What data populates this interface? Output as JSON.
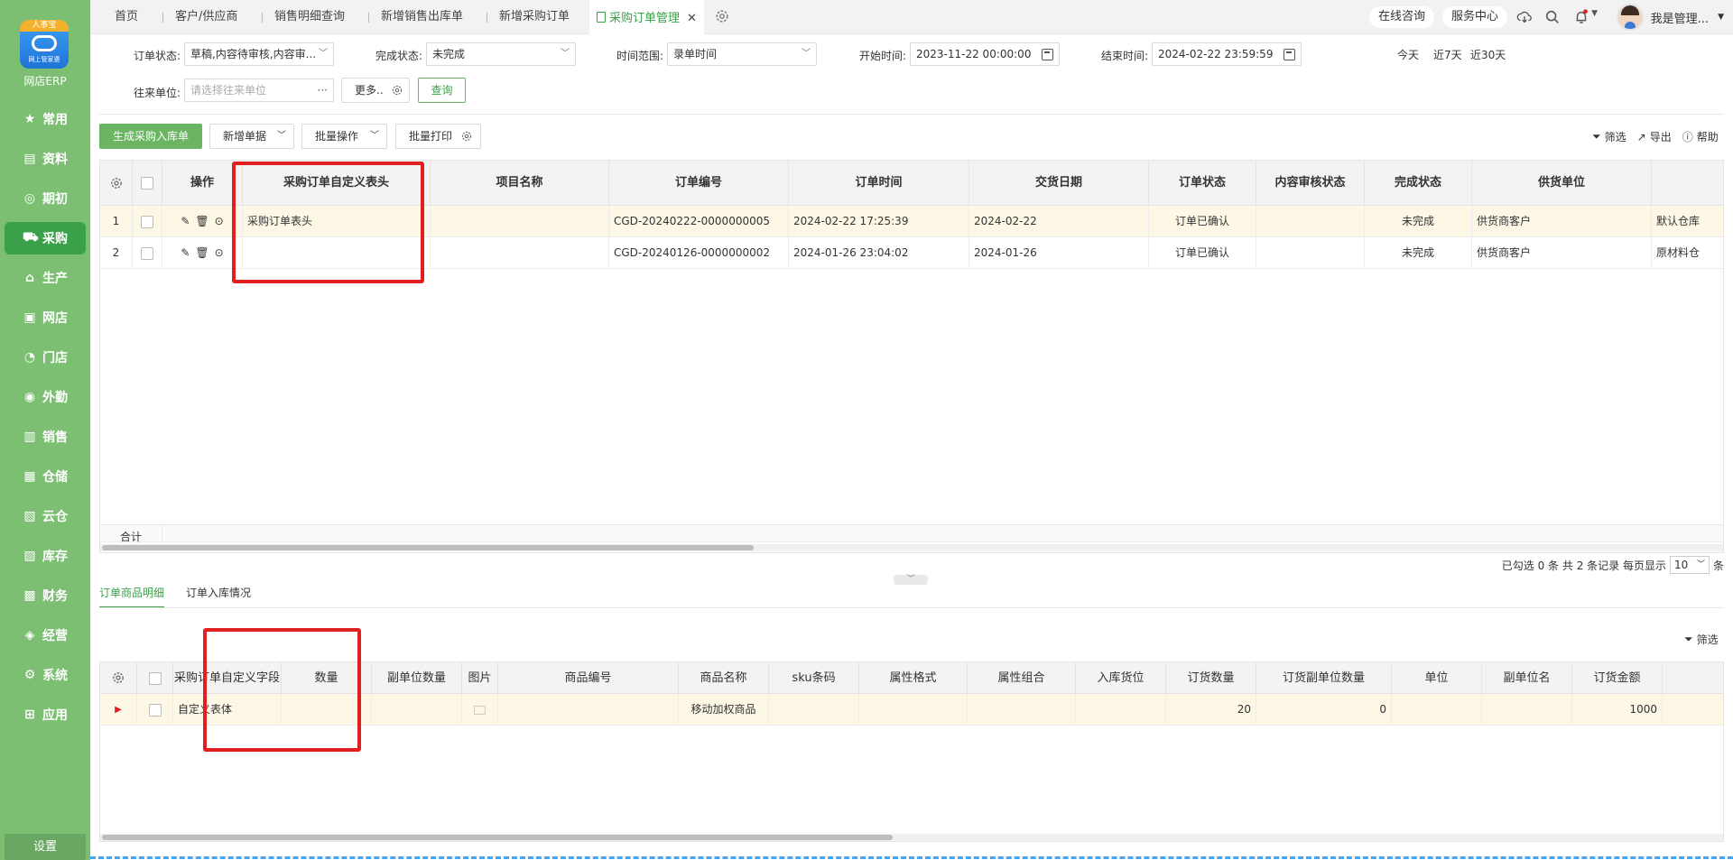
{
  "sidebar": {
    "logo_ribbon": "人事宝",
    "logo_sub": "网上管家婆",
    "brand": "网店ERP",
    "items": [
      {
        "label": "常用",
        "icon": "star-icon"
      },
      {
        "label": "资料",
        "icon": "document-icon"
      },
      {
        "label": "期初",
        "icon": "target-icon"
      },
      {
        "label": "采购",
        "icon": "cart-icon"
      },
      {
        "label": "生产",
        "icon": "factory-icon"
      },
      {
        "label": "网店",
        "icon": "shop-icon"
      },
      {
        "label": "门店",
        "icon": "pie-icon"
      },
      {
        "label": "外勤",
        "icon": "location-icon"
      },
      {
        "label": "销售",
        "icon": "bar-chart-icon"
      },
      {
        "label": "仓储",
        "icon": "warehouse-icon"
      },
      {
        "label": "云仓",
        "icon": "cloud-warehouse-icon"
      },
      {
        "label": "库存",
        "icon": "stock-icon"
      },
      {
        "label": "财务",
        "icon": "wallet-icon"
      },
      {
        "label": "经营",
        "icon": "trend-icon"
      },
      {
        "label": "系统",
        "icon": "gear-icon"
      },
      {
        "label": "应用",
        "icon": "plus-square-icon"
      }
    ],
    "active_index": 3,
    "settings": "设置"
  },
  "tabs": [
    {
      "label": "首页"
    },
    {
      "label": "客户/供应商"
    },
    {
      "label": "销售明细查询"
    },
    {
      "label": "新增销售出库单"
    },
    {
      "label": "新增采购订单"
    },
    {
      "label": "采购订单管理"
    }
  ],
  "topright": {
    "consult": "在线咨询",
    "service": "服务中心",
    "user": "我是管理..."
  },
  "filters": {
    "order_status_label": "订单状态:",
    "order_status_value": "草稿,内容待审核,内容审...",
    "complete_status_label": "完成状态:",
    "complete_status_value": "未完成",
    "time_range_label": "时间范围:",
    "time_range_value": "录单时间",
    "start_label": "开始时间:",
    "start_value": "2023-11-22 00:00:00",
    "end_label": "结束时间:",
    "end_value": "2024-02-22 23:59:59",
    "quick": [
      "今天",
      "近7天",
      "近30天"
    ],
    "partner_label": "往来单位:",
    "partner_placeholder": "请选择往来单位",
    "more": "更多..",
    "query": "查询"
  },
  "actions": {
    "gen_inbound": "生成采购入库单",
    "new_doc": "新增单据",
    "batch_op": "批量操作",
    "batch_print": "批量打印",
    "filter": "筛选",
    "export": "导出",
    "help": "帮助"
  },
  "main_table": {
    "headers": [
      "操作",
      "采购订单自定义表头",
      "项目名称",
      "订单编号",
      "订单时间",
      "交货日期",
      "订单状态",
      "内容审核状态",
      "完成状态",
      "供货单位"
    ],
    "rows": [
      {
        "no": "1",
        "custom_header": "采购订单表头",
        "project": "",
        "order_no": "CGD-20240222-0000000005",
        "order_time": "2024-02-22 17:25:39",
        "delivery": "2024-02-22",
        "status": "订单已确认",
        "audit": "",
        "complete": "未完成",
        "supplier": "供货商客户",
        "warehouse": "默认仓库"
      },
      {
        "no": "2",
        "custom_header": "",
        "project": "",
        "order_no": "CGD-20240126-0000000002",
        "order_time": "2024-01-26 23:04:02",
        "delivery": "2024-01-26",
        "status": "订单已确认",
        "audit": "",
        "complete": "未完成",
        "supplier": "供货商客户",
        "warehouse": "原材料仓"
      }
    ],
    "total_label": "合计"
  },
  "pagination": {
    "selected": "已勾选 0 条",
    "total": "共 2 条记录",
    "per_page_label": "每页显示",
    "per_page": "10",
    "unit": "条"
  },
  "subtabs": [
    "订单商品明细",
    "订单入库情况"
  ],
  "detail_table": {
    "headers": [
      "采购订单自定义字段",
      "数量",
      "副单位数量",
      "图片",
      "商品编号",
      "商品名称",
      "sku条码",
      "属性格式",
      "属性组合",
      "入库货位",
      "订货数量",
      "订货副单位数量",
      "单位",
      "副单位名",
      "订货金额"
    ],
    "rows": [
      {
        "custom_field": "自定义表体",
        "qty": "",
        "sub_qty": "",
        "code": "",
        "name": "移动加权商品",
        "sku": "",
        "attr_fmt": "",
        "attr_combo": "",
        "location": "",
        "order_qty": "20",
        "order_sub_qty": "0",
        "unit": "",
        "sub_unit": "",
        "amount": "1000"
      }
    ]
  },
  "colors": {
    "sidebar": "#7cbf73",
    "accent": "#3aa04a",
    "highlight": "#e02020"
  }
}
